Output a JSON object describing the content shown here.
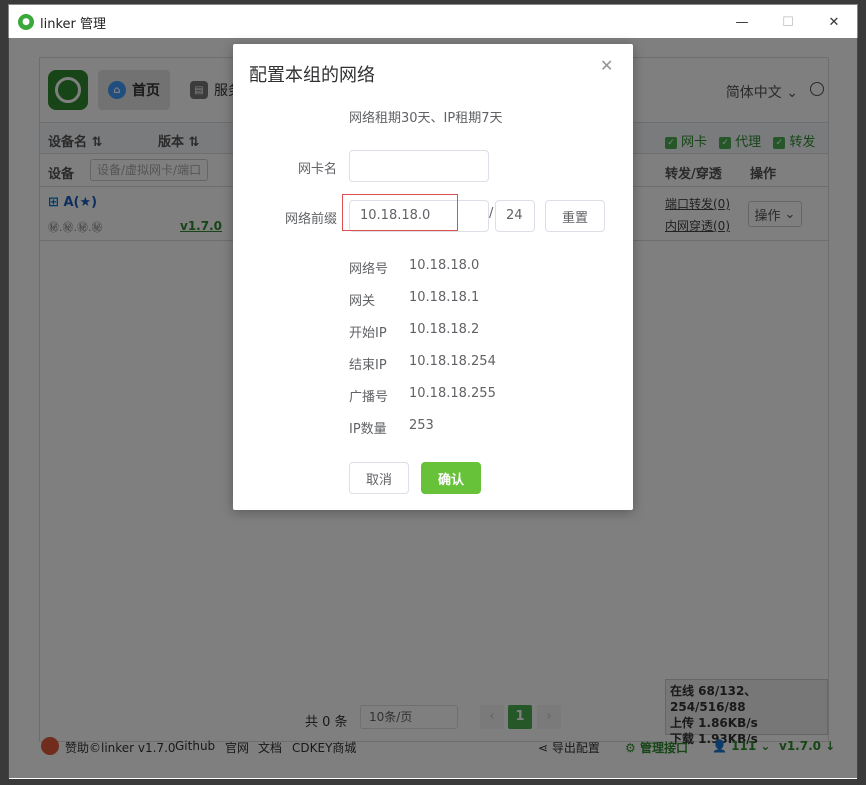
{
  "window": {
    "title": "linker 管理"
  },
  "app": {
    "nav": {
      "home": "首页",
      "servers": "服务器"
    },
    "language": "简体中文",
    "table": {
      "headers": {
        "device": "设备名",
        "version": "版本",
        "nic": "网卡",
        "proxy": "代理",
        "forward": "转发"
      },
      "filter_label": "设备",
      "filter_placeholder": "设备/虚拟网卡/端口",
      "col_forward": "转发/穿透",
      "col_ops": "操作"
    },
    "row": {
      "name": "A(★)",
      "tags": "㊙.㊙.㊙.㊙",
      "version": "v1.7.0",
      "port_forward": "端口转发(0)",
      "tunnel": "内网穿透(0)",
      "ops": "操作"
    },
    "pager": {
      "total": "共 0 条",
      "page_size": "10条/页",
      "current": "1"
    },
    "status": {
      "online": "在线 68/132、254/516/88",
      "upload": "上传 1.86KB/s",
      "download": "下载 1.93KB/s"
    },
    "footer": {
      "sponsor": "赞助©linker v1.7.0",
      "links": [
        "Github",
        "官网",
        "文档",
        "CDKEY商城"
      ],
      "export": "导出配置",
      "mgmt": "管理接口",
      "users": "111",
      "version": "v1.7.0"
    }
  },
  "dialog": {
    "title": "配置本组的网络",
    "subtitle": "网络租期30天、IP租期7天",
    "nic_label": "网卡名",
    "nic_value": "",
    "prefix_label": "网络前缀",
    "prefix_value": "10.18.18.0",
    "mask_value": "24",
    "reset": "重置",
    "info": [
      {
        "key": "网络号",
        "value": "10.18.18.0"
      },
      {
        "key": "网关",
        "value": "10.18.18.1"
      },
      {
        "key": "开始IP",
        "value": "10.18.18.2"
      },
      {
        "key": "结束IP",
        "value": "10.18.18.254"
      },
      {
        "key": "广播号",
        "value": "10.18.18.255"
      },
      {
        "key": "IP数量",
        "value": "253"
      }
    ],
    "cancel": "取消",
    "confirm": "确认"
  }
}
